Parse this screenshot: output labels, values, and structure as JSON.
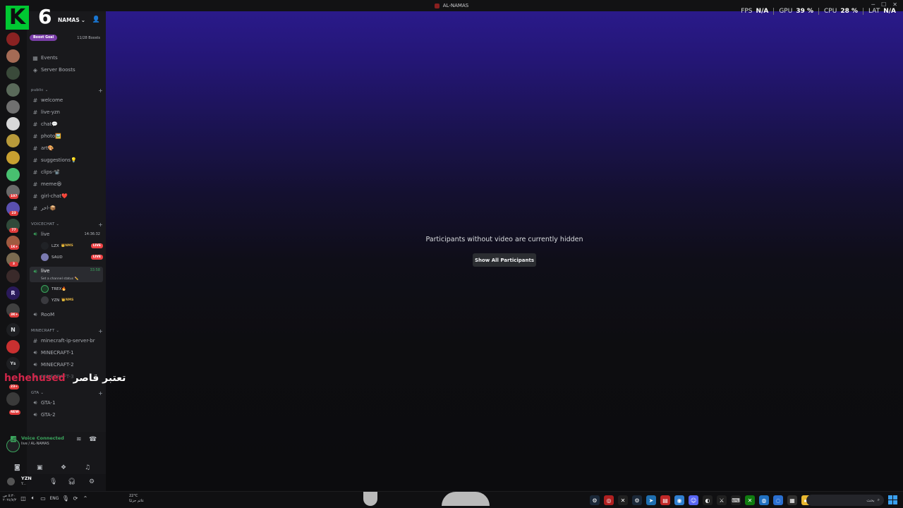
{
  "window": {
    "title": "AL-NAMAS"
  },
  "overlay_stats": {
    "fps_label": "FPS",
    "fps_value": "N/A",
    "gpu_label": "GPU",
    "gpu_value": "39 %",
    "cpu_label": "CPU",
    "cpu_value": "28 %",
    "lat_label": "LAT",
    "lat_value": "N/A"
  },
  "watermark": {
    "letter": "K",
    "number": "6"
  },
  "server": {
    "name": "NAMAS"
  },
  "boost": {
    "goal_label": "Boost Goal",
    "count": "11/28 Boosts"
  },
  "top_links": [
    {
      "label": "Events"
    },
    {
      "label": "Server Boosts"
    }
  ],
  "categories": {
    "public": "public",
    "voicechat": "VOICECHAT",
    "minecraft": "MINECRAFT",
    "gta": "GTA"
  },
  "text_channels": [
    {
      "label": "welcome"
    },
    {
      "label": "live-yzn"
    },
    {
      "label": "chat💬"
    },
    {
      "label": "photo🖼️"
    },
    {
      "label": "art🎨"
    },
    {
      "label": "suggestions💡"
    },
    {
      "label": "clips-📽️"
    },
    {
      "label": "meme😆"
    },
    {
      "label": "girl-chat❤️"
    },
    {
      "label": "اخر-📦"
    }
  ],
  "voice_channels": {
    "live1": {
      "label": "live",
      "timer": "14:36:32"
    },
    "live1_users": [
      {
        "name": "LZX",
        "tag": "👑NMS",
        "badge": "LIVE"
      },
      {
        "name": "SAUD",
        "tag": "",
        "badge": "LIVE"
      }
    ],
    "live2": {
      "label": "live",
      "timer": "33:58",
      "status": "Set a channel status ✏️"
    },
    "live2_users": [
      {
        "name": "TREX🔥",
        "tag": ""
      },
      {
        "name": "YZN",
        "tag": "👑NMS"
      }
    ],
    "room": {
      "label": "RooM"
    }
  },
  "minecraft_channels": [
    {
      "label": "minecraft-ip-server-br"
    },
    {
      "label": "MINECRAFT-1"
    },
    {
      "label": "MINECRAFT-2"
    },
    {
      "label": "MINECRAFT-3"
    }
  ],
  "gta_channels": [
    {
      "label": "GTA-1"
    },
    {
      "label": "GTA-2"
    }
  ],
  "server_badges": [
    "107",
    "23",
    "77",
    "1K+",
    "3",
    "3K+",
    "23+",
    "NEW"
  ],
  "voice_panel": {
    "status": "Voice Connected",
    "channel": "live / AL-NAMAS"
  },
  "user_panel": {
    "name": "YZN",
    "status": "Y..."
  },
  "stage": {
    "message": "Participants without video are currently hidden",
    "button": "Show All Participants"
  },
  "overlay_caption": {
    "red": "hehehused",
    "white": "تعتبر قاصر"
  },
  "taskbar": {
    "time": "٥:٣٠ ص",
    "date": "٢٠٢٤/٧/٢",
    "lang": "ENG",
    "temp": "22°C",
    "weather": "غائم جزئيًا",
    "search": "بحث"
  },
  "colors": {
    "accent_green": "#3ba55d",
    "live_red": "#ed4245",
    "boost_purple": "#7a3ea8",
    "stage_top": "#2a1a8a"
  }
}
